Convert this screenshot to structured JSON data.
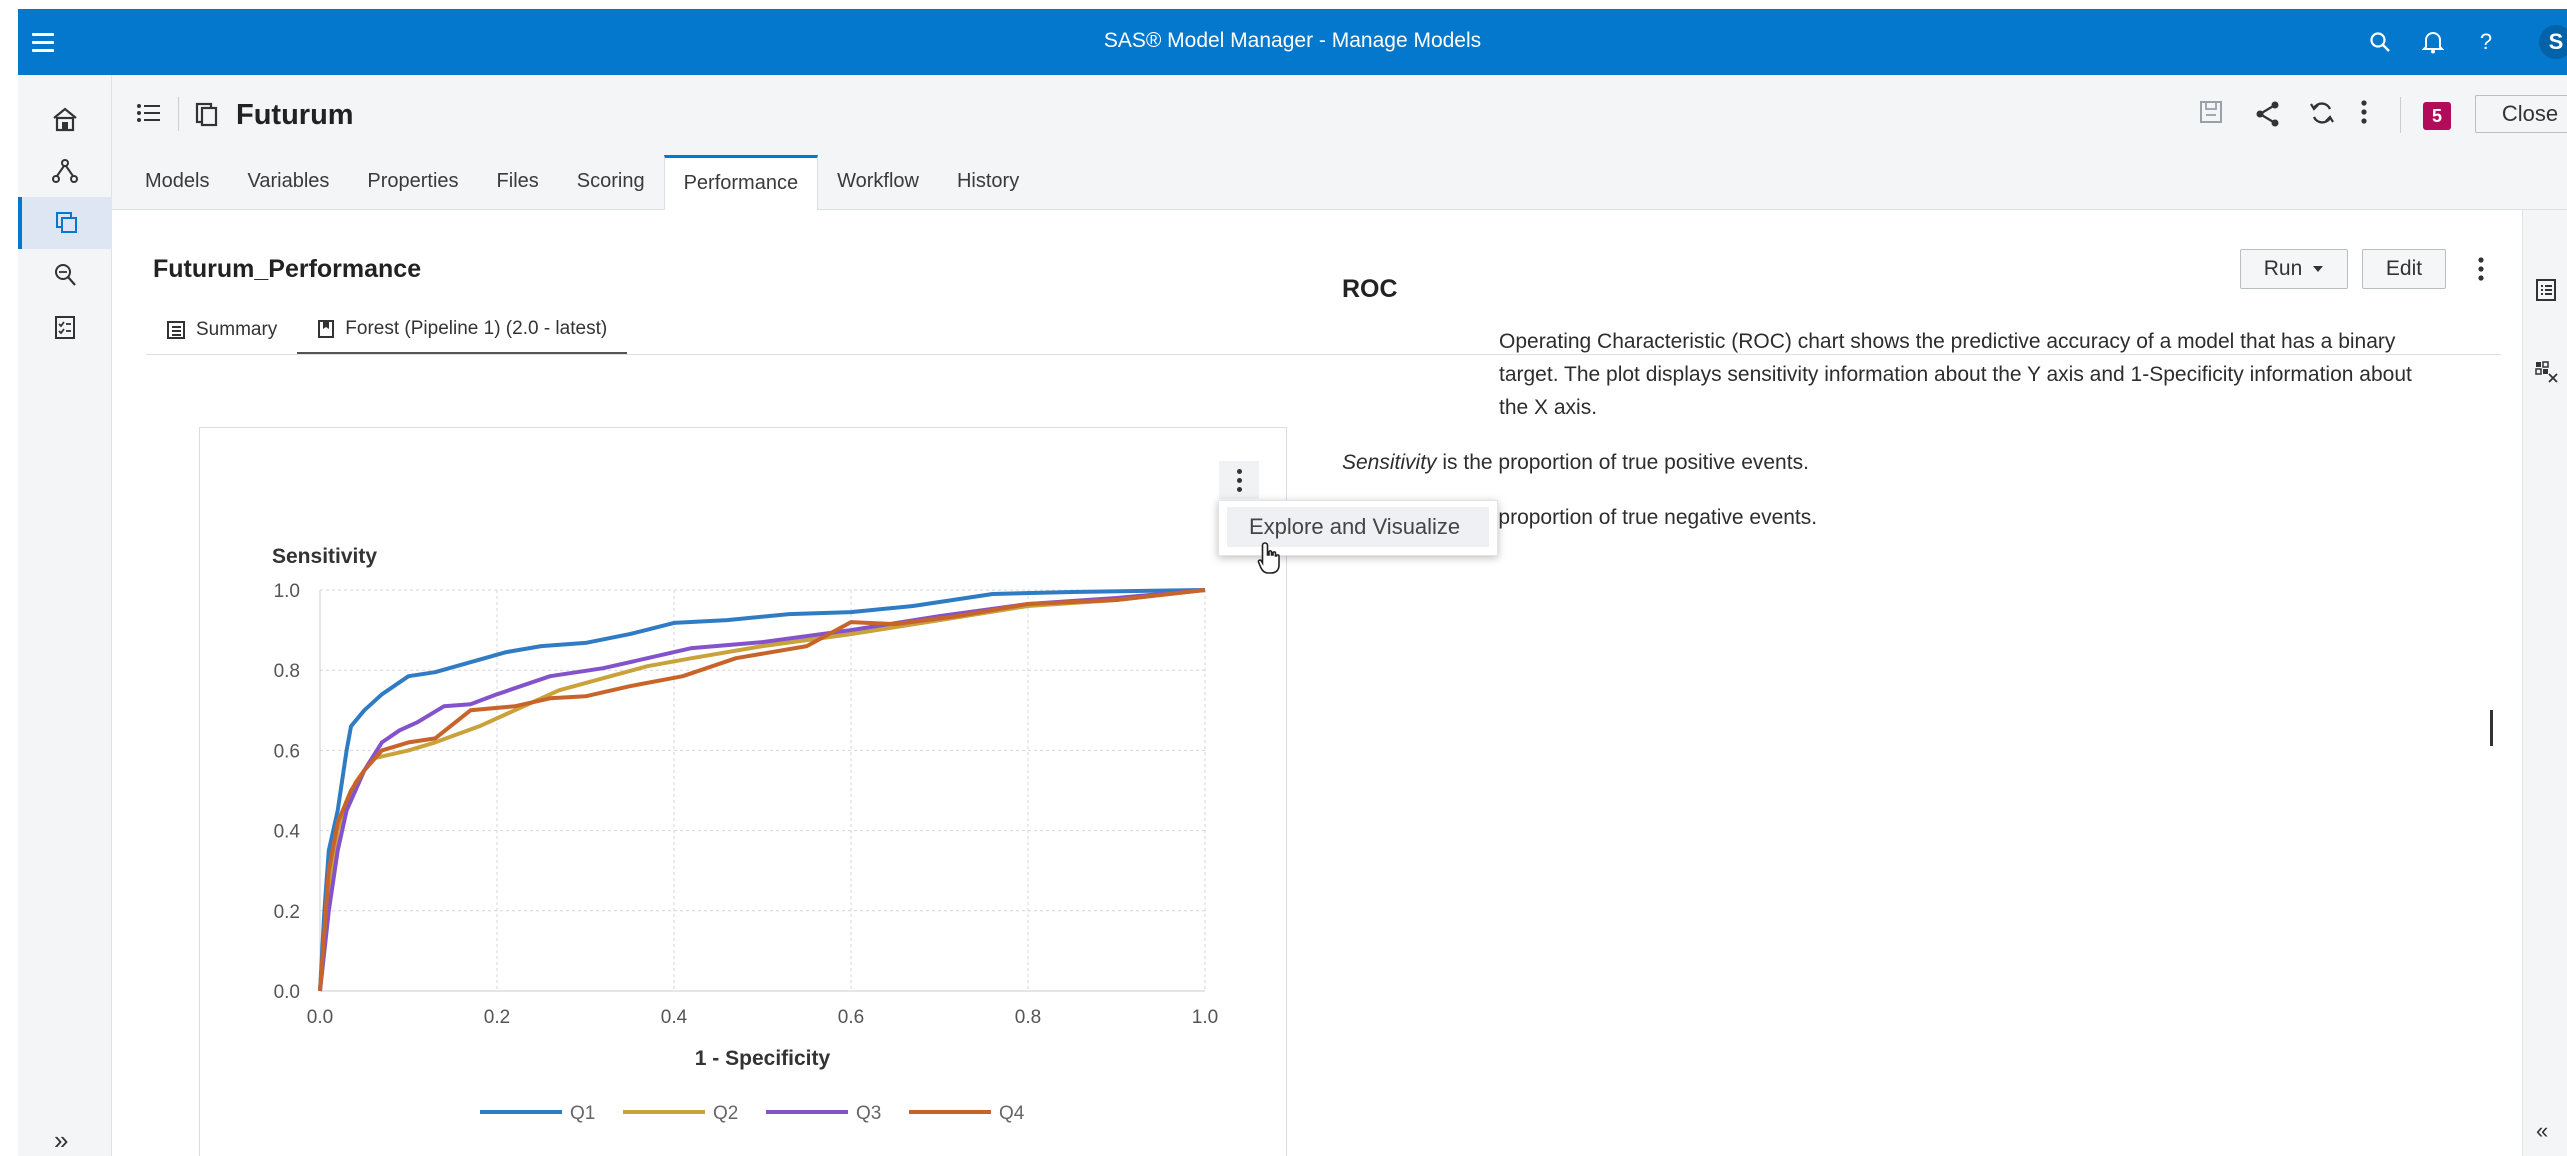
{
  "app": {
    "title": "SAS® Model Manager - Manage Models",
    "avatar_letter": "S",
    "brand_color": "#0378cd"
  },
  "topbar_icons": [
    "menu-icon",
    "search-icon",
    "bell-icon",
    "help-icon"
  ],
  "leftnav": {
    "items": [
      "home-icon",
      "pipeline-icon",
      "models-icon",
      "search-models-icon",
      "tasks-icon"
    ],
    "active_index": 2,
    "expand_label": "»"
  },
  "header": {
    "project_name": "Futurum",
    "badge": "5",
    "close_label": "Close",
    "tabs": [
      "Models",
      "Variables",
      "Properties",
      "Files",
      "Scoring",
      "Performance",
      "Workflow",
      "History"
    ],
    "active_tab": 5
  },
  "main": {
    "title": "Futurum_Performance",
    "run_label": "Run",
    "edit_label": "Edit",
    "subtabs": [
      {
        "label": "Summary",
        "icon": "summary-icon"
      },
      {
        "label": "Forest (Pipeline 1) (2.0 - latest)",
        "icon": "bookmark-icon"
      }
    ],
    "active_subtab": 1
  },
  "menu": {
    "item": "Explore and Visualize"
  },
  "roc": {
    "title": "ROC",
    "p1": "Operating Characteristic (ROC) chart shows the predictive accuracy of a model that has a binary target. The plot displays sensitivity information about the Y axis and 1-Specificity information about the X axis.",
    "p2_em": "Sensitivity",
    "p2_rest": " is the proportion of true positive events.",
    "p3": "Specificity is the proportion of true negative events."
  },
  "rightrail": {
    "collapse_label": "«"
  },
  "chart_data": {
    "type": "line",
    "xlabel": "1 - Specificity",
    "ylabel": "Sensitivity",
    "xlim": [
      0,
      1
    ],
    "ylim": [
      0,
      1
    ],
    "xticks": [
      "0.0",
      "0.2",
      "0.4",
      "0.6",
      "0.8",
      "1.0"
    ],
    "yticks": [
      "0.0",
      "0.2",
      "0.4",
      "0.6",
      "0.8",
      "1.0"
    ],
    "grid": true,
    "legend_position": "bottom",
    "series": [
      {
        "name": "Q1",
        "color": "#2f7cc4",
        "points": [
          [
            0,
            0
          ],
          [
            0.005,
            0.2
          ],
          [
            0.01,
            0.35
          ],
          [
            0.02,
            0.45
          ],
          [
            0.03,
            0.6
          ],
          [
            0.035,
            0.66
          ],
          [
            0.05,
            0.7
          ],
          [
            0.07,
            0.74
          ],
          [
            0.1,
            0.785
          ],
          [
            0.13,
            0.795
          ],
          [
            0.17,
            0.82
          ],
          [
            0.21,
            0.845
          ],
          [
            0.25,
            0.86
          ],
          [
            0.3,
            0.868
          ],
          [
            0.35,
            0.89
          ],
          [
            0.4,
            0.918
          ],
          [
            0.46,
            0.925
          ],
          [
            0.53,
            0.94
          ],
          [
            0.6,
            0.945
          ],
          [
            0.67,
            0.96
          ],
          [
            0.76,
            0.99
          ],
          [
            0.85,
            0.995
          ],
          [
            1,
            1
          ]
        ]
      },
      {
        "name": "Q2",
        "color": "#c9a23a",
        "points": [
          [
            0,
            0
          ],
          [
            0.01,
            0.25
          ],
          [
            0.02,
            0.4
          ],
          [
            0.04,
            0.52
          ],
          [
            0.06,
            0.58
          ],
          [
            0.08,
            0.59
          ],
          [
            0.1,
            0.6
          ],
          [
            0.13,
            0.62
          ],
          [
            0.18,
            0.66
          ],
          [
            0.22,
            0.7
          ],
          [
            0.27,
            0.75
          ],
          [
            0.32,
            0.78
          ],
          [
            0.37,
            0.81
          ],
          [
            0.42,
            0.83
          ],
          [
            0.5,
            0.86
          ],
          [
            0.6,
            0.89
          ],
          [
            0.7,
            0.925
          ],
          [
            0.8,
            0.96
          ],
          [
            0.9,
            0.975
          ],
          [
            1,
            1
          ]
        ]
      },
      {
        "name": "Q3",
        "color": "#8553c9",
        "points": [
          [
            0,
            0
          ],
          [
            0.01,
            0.2
          ],
          [
            0.02,
            0.35
          ],
          [
            0.03,
            0.45
          ],
          [
            0.05,
            0.55
          ],
          [
            0.07,
            0.62
          ],
          [
            0.09,
            0.65
          ],
          [
            0.11,
            0.67
          ],
          [
            0.14,
            0.71
          ],
          [
            0.17,
            0.715
          ],
          [
            0.2,
            0.74
          ],
          [
            0.26,
            0.785
          ],
          [
            0.32,
            0.805
          ],
          [
            0.37,
            0.83
          ],
          [
            0.42,
            0.855
          ],
          [
            0.5,
            0.87
          ],
          [
            0.6,
            0.9
          ],
          [
            0.7,
            0.935
          ],
          [
            0.8,
            0.965
          ],
          [
            0.9,
            0.98
          ],
          [
            1,
            1
          ]
        ]
      },
      {
        "name": "Q4",
        "color": "#c8642a",
        "points": [
          [
            0,
            0
          ],
          [
            0.01,
            0.3
          ],
          [
            0.02,
            0.42
          ],
          [
            0.035,
            0.5
          ],
          [
            0.05,
            0.55
          ],
          [
            0.07,
            0.6
          ],
          [
            0.1,
            0.62
          ],
          [
            0.13,
            0.63
          ],
          [
            0.17,
            0.7
          ],
          [
            0.22,
            0.71
          ],
          [
            0.26,
            0.73
          ],
          [
            0.3,
            0.735
          ],
          [
            0.35,
            0.76
          ],
          [
            0.41,
            0.785
          ],
          [
            0.47,
            0.83
          ],
          [
            0.55,
            0.86
          ],
          [
            0.6,
            0.92
          ],
          [
            0.65,
            0.915
          ],
          [
            0.72,
            0.935
          ],
          [
            0.8,
            0.965
          ],
          [
            0.9,
            0.975
          ],
          [
            1,
            1
          ]
        ]
      }
    ]
  }
}
